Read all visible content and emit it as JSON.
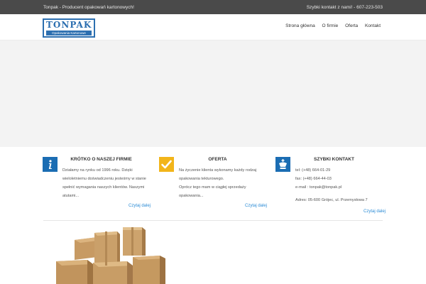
{
  "topbar": {
    "left_text": "Tonpak - Producent opakowań kartonowych!",
    "right_text": "Szybki kontakt z nami! - 607-223-503"
  },
  "logo": {
    "word": "TONPAK",
    "subtitle": "Opakowania Kartonowe"
  },
  "nav": [
    "Strona główna",
    "O firmie",
    "Oferta",
    "Kontakt"
  ],
  "columns": {
    "about": {
      "title": "KRÓTKO O NASZEJ FIRMIE",
      "lines": [
        "Działamy na rynku od 1996 roku. Dzięki wieloletniemu doświadczeniu jesteśmy w stanie spełnić wymagania naszych klientów. Naszymi atutami..."
      ],
      "more": "Czytaj dalej",
      "icon": "info-icon"
    },
    "offer": {
      "title": "OFERTA",
      "lines": [
        "Na życzenie klienta wykonamy każdy rodzaj opakowania tekturowego.",
        "Oprócz tego mam w ciągłej sprzedaży opakowania..."
      ],
      "more": "Czytaj dalej",
      "icon": "check-icon"
    },
    "contact": {
      "title": "SZYBKI KONTAKT",
      "tel": "tel: (+48) 664-01-29",
      "fax": "fax: (+48) 664-44-03",
      "email": "e-mail : tonpak@tonpak.pl",
      "address": "Adres: 05-600 Grójec, ul. Przemysłowa 7",
      "more": "Czytaj dalej",
      "icon": "chess-king-icon"
    }
  },
  "colors": {
    "topbar": "#4a4a4a",
    "brand_blue": "#1b6db3",
    "accent_yellow": "#f2b51a",
    "link": "#2a8bd5"
  }
}
